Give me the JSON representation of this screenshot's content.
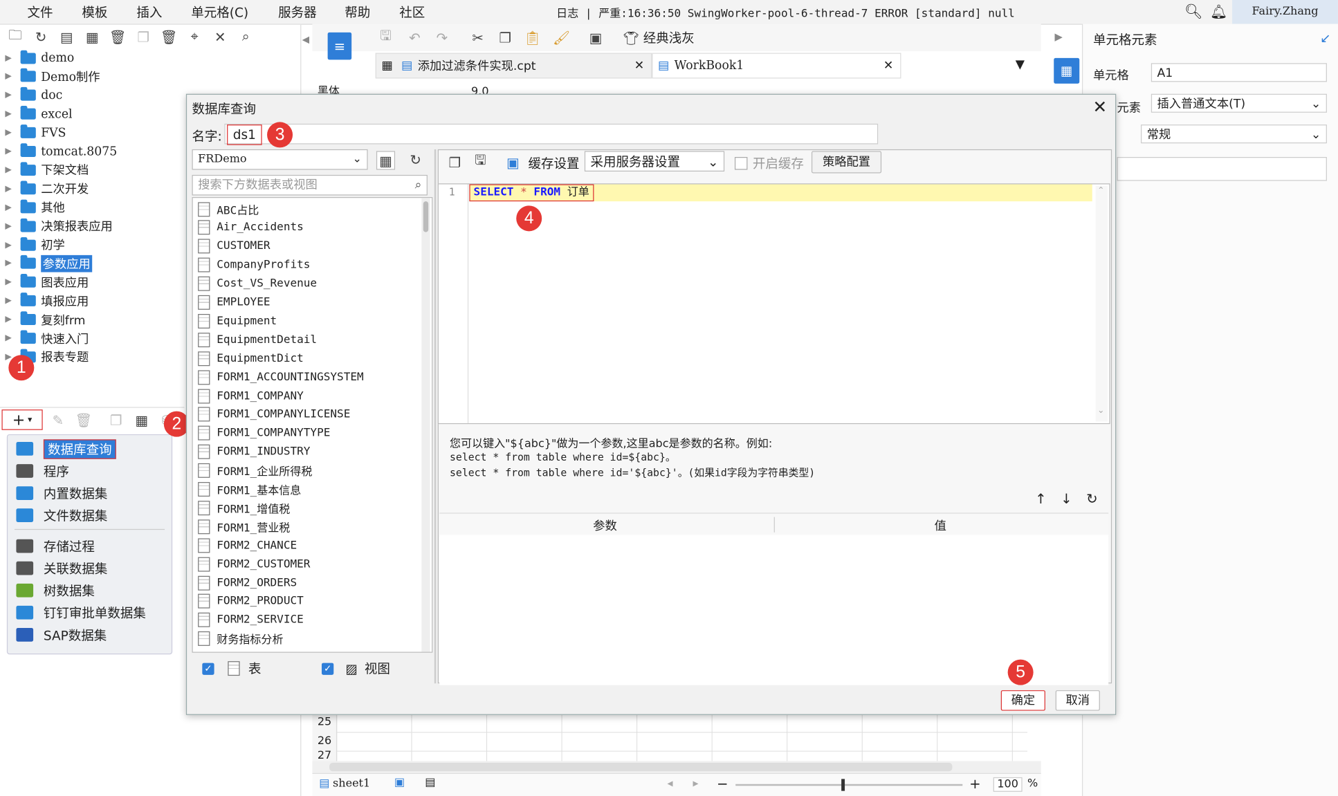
{
  "menubar": {
    "items": [
      "文件",
      "模板",
      "插入",
      "单元格(C)",
      "服务器",
      "帮助",
      "社区"
    ],
    "log": "日志 | 严重:16:36:50 SwingWorker-pool-6-thread-7 ERROR [standard] null",
    "user": "Fairy.Zhang"
  },
  "tree": {
    "items": [
      "demo",
      "Demo制作",
      "doc",
      "excel",
      "FVS",
      "tomcat.8075",
      "下架文档",
      "二次开发",
      "其他",
      "决策报表应用",
      "初学",
      "参数应用",
      "图表应用",
      "填报应用",
      "复刻frm",
      "快速入门",
      "报表专题"
    ],
    "selected_index": 11
  },
  "datasource_menu": {
    "items": [
      "数据库查询",
      "程序",
      "内置数据集",
      "文件数据集",
      "存储过程",
      "关联数据集",
      "树数据集",
      "钉钉审批单数据集",
      "SAP数据集"
    ]
  },
  "editor": {
    "toolbar_style": "经典浅灰",
    "tabs": [
      "添加过滤条件实现.cpt",
      "WorkBook1"
    ],
    "font": "黑体",
    "font_size": "9.0",
    "rows": [
      "25",
      "26",
      "27"
    ],
    "sheet": "sheet1",
    "zoom": "100",
    "zoom_unit": "%"
  },
  "right_panel": {
    "title": "单元格元素",
    "cell_label": "单元格",
    "cell_value": "A1",
    "insert_label": "元素",
    "insert_value": "插入普通文本(T)",
    "style_value": "常规"
  },
  "dialog": {
    "title": "数据库查询",
    "name_label": "名字:",
    "name_value": "ds1",
    "connection": "FRDemo",
    "search_placeholder": "搜索下方数据表或视图",
    "tables": [
      "ABC占比",
      "Air_Accidents",
      "CUSTOMER",
      "CompanyProfits",
      "Cost_VS_Revenue",
      "EMPLOYEE",
      "Equipment",
      "EquipmentDetail",
      "EquipmentDict",
      "FORM1_ACCOUNTINGSYSTEM",
      "FORM1_COMPANY",
      "FORM1_COMPANYLICENSE",
      "FORM1_COMPANYTYPE",
      "FORM1_INDUSTRY",
      "FORM1_企业所得税",
      "FORM1_基本信息",
      "FORM1_增值税",
      "FORM1_营业税",
      "FORM2_CHANCE",
      "FORM2_CUSTOMER",
      "FORM2_ORDERS",
      "FORM2_PRODUCT",
      "FORM2_SERVICE",
      "财务指标分析"
    ],
    "check_table": "表",
    "check_view": "视图",
    "cache_label": "缓存设置",
    "cache_select": "采用服务器设置",
    "enable_cache": "开启缓存",
    "strategy_button": "策略配置",
    "sql_line_no": "1",
    "sql_select": "SELECT",
    "sql_star": "*",
    "sql_from": "FROM",
    "sql_table": "订单",
    "help_line1": "您可以键入\"${abc}\"做为一个参数,这里abc是参数的名称。例如:",
    "help_line2": "select * from table where id=${abc}。",
    "help_line3": "select * from table where id='${abc}'。(如果id字段为字符串类型)",
    "param_col": "参数",
    "value_col": "值",
    "ok_button": "确定",
    "cancel_button": "取消"
  },
  "annotations": [
    "1",
    "2",
    "3",
    "4",
    "5"
  ],
  "colors": {
    "accent": "#2f7ed8",
    "badge": "#e53935",
    "highlight": "#fff8b0",
    "sql_keyword": "#1a1aff"
  }
}
